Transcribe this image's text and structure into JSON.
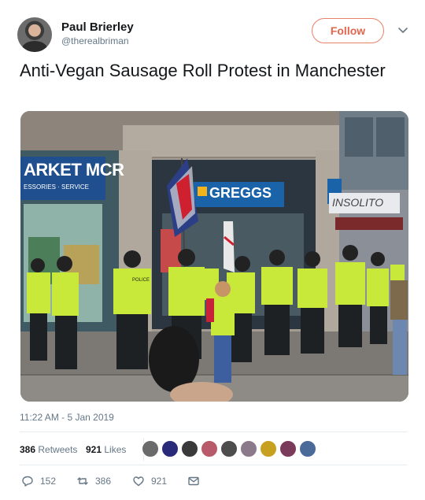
{
  "author": {
    "name": "Paul Brierley",
    "handle": "@therealbriman"
  },
  "follow_label": "Follow",
  "tweet_text": "Anti-Vegan Sausage Roll Protest in Manchester",
  "photo": {
    "sign_market": "ARKET MCR",
    "sign_market_sub": "ESSORIES · SERVICE",
    "sign_greggs": "GREGGS",
    "sign_insolito": "INSOLITO",
    "vest_text": "POLICE"
  },
  "timestamp": "11:22 AM - 5 Jan 2019",
  "stats": {
    "retweets_count": "386",
    "retweets_label": "Retweets",
    "likes_count": "921",
    "likes_label": "Likes"
  },
  "actions": {
    "reply_count": "152",
    "retweet_count": "386",
    "like_count": "921"
  },
  "colors": {
    "follow_accent": "#e0674d",
    "muted_text": "#657786",
    "hi_vis": "#c8e83a"
  }
}
